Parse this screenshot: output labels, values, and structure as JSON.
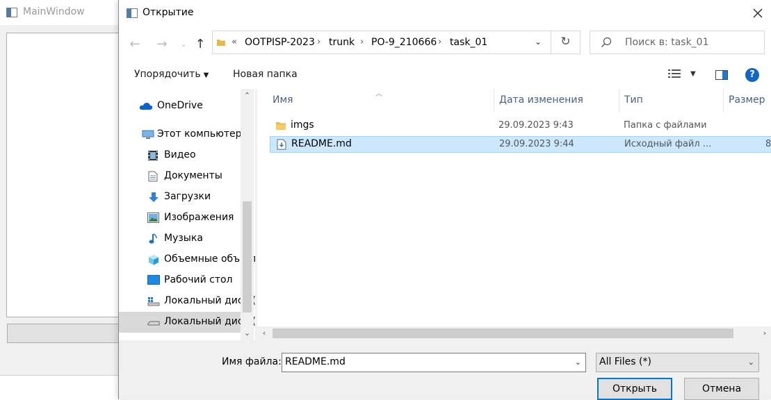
{
  "main_window": {
    "title": "MainWindow"
  },
  "dialog": {
    "title": "Открытие",
    "address": {
      "overflow": "«",
      "crumbs": [
        "OOTPISP-2023",
        "trunk",
        "PO-9_210666",
        "task_01"
      ]
    },
    "search_placeholder": "Поиск в: task_01",
    "toolbar": {
      "organize_label": "Упорядочить",
      "new_folder_label": "Новая папка"
    },
    "nav_pane": {
      "items": [
        {
          "label": "OneDrive",
          "icon": "onedrive-icon"
        },
        {
          "label": "Этот компьютер",
          "icon": "computer-icon"
        },
        {
          "label": "Видео",
          "icon": "video-icon"
        },
        {
          "label": "Документы",
          "icon": "documents-icon"
        },
        {
          "label": "Загрузки",
          "icon": "downloads-icon"
        },
        {
          "label": "Изображения",
          "icon": "pictures-icon"
        },
        {
          "label": "Музыка",
          "icon": "music-icon"
        },
        {
          "label": "Объемные объекты",
          "icon": "3d-objects-icon"
        },
        {
          "label": "Рабочий стол",
          "icon": "desktop-icon"
        },
        {
          "label": "Локальный диск (C:)",
          "icon": "windows-drive-icon"
        },
        {
          "label": "Локальный диск (D:)",
          "icon": "drive-icon"
        }
      ]
    },
    "columns": {
      "name": "Имя",
      "modified": "Дата изменения",
      "type": "Тип",
      "size": "Размер"
    },
    "files": [
      {
        "name": "imgs",
        "modified": "29.09.2023 9:43",
        "type": "Папка с файлами",
        "size": "",
        "icon": "folder-icon"
      },
      {
        "name": "README.md",
        "modified": "29.09.2023 9:44",
        "type": "Исходный файл ...",
        "size": "8",
        "icon": "markdown-file-icon"
      }
    ],
    "filename_label": "Имя файла:",
    "filename_value": "README.md",
    "filter_value": "All Files (*)",
    "open_label": "Открыть",
    "cancel_label": "Отмена"
  },
  "colors": {
    "selection": "#cce8ff",
    "selection_border": "#99d1ff",
    "accent": "#0078d7",
    "help": "#1266c4",
    "folder": "#e8b84b"
  }
}
